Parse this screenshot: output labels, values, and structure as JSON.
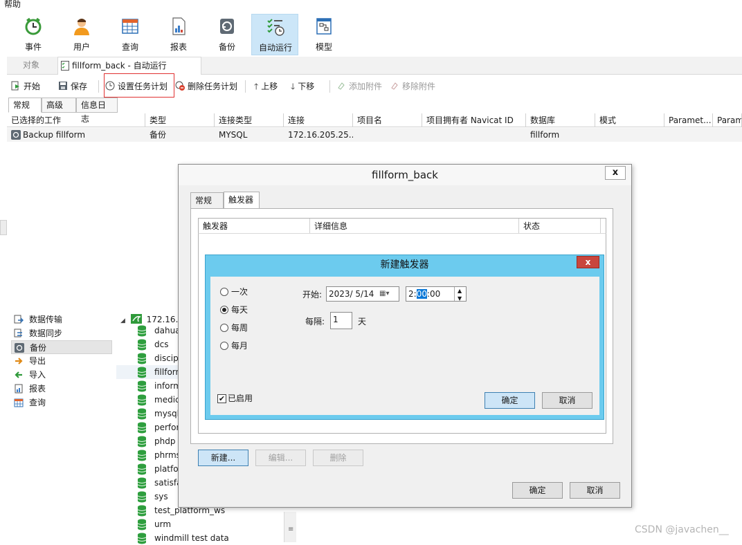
{
  "menu": {
    "help": "帮助"
  },
  "ribbon": {
    "event": "事件",
    "user": "用户",
    "query": "查询",
    "report": "报表",
    "backup": "备份",
    "automation": "自动运行",
    "model": "模型"
  },
  "tabs": {
    "objects": "对象",
    "active": "fillform_back - 自动运行"
  },
  "toolbar": {
    "start": "开始",
    "save": "保存",
    "set_schedule": "设置任务计划",
    "delete_schedule": "删除任务计划",
    "move_up": "上移",
    "move_down": "下移",
    "add_attachment": "添加附件",
    "remove_attachment": "移除附件"
  },
  "subtabs": [
    "常规",
    "高级",
    "信息日志"
  ],
  "grid": {
    "headers": [
      "已选择的工作",
      "类型",
      "连接类型",
      "连接",
      "项目名",
      "项目拥有者 Navicat ID",
      "数据库",
      "模式",
      "Paramet...",
      "Param"
    ],
    "row": [
      "Backup fillform",
      "备份",
      "MYSQL",
      "172.16.205.25...",
      "",
      "",
      "fillform",
      "",
      "",
      ""
    ]
  },
  "nav": {
    "items": [
      "数据传输",
      "数据同步",
      "备份",
      "导出",
      "导入",
      "报表",
      "查询"
    ],
    "selected": "备份"
  },
  "tree": {
    "server": "172.16.2",
    "databases": [
      "dahua",
      "dcs",
      "discip",
      "fillforn",
      "inform",
      "medic",
      "mysql",
      "perfor",
      "phdp",
      "phrms",
      "platfo",
      "satisfa",
      "sys",
      "test_platform_ws",
      "urm",
      "windmill test data"
    ]
  },
  "dialog": {
    "title": "fillform_back",
    "close": "x",
    "tabs": [
      "常规",
      "触发器"
    ],
    "columns": [
      "触发器",
      "详细信息",
      "状态"
    ],
    "new_button": "新建...",
    "edit_button": "编辑...",
    "delete_button": "删除",
    "ok": "确定",
    "cancel": "取消"
  },
  "trigger_dialog": {
    "title": "新建触发器",
    "close": "x",
    "options": [
      "一次",
      "每天",
      "每周",
      "每月"
    ],
    "selected_option": "每天",
    "start_label": "开始:",
    "start_date": "2023/ 5/14",
    "start_time_h": "2:",
    "start_time_m": "00",
    "start_time_s": ":00",
    "interval_label": "每隔:",
    "interval_value": "1",
    "interval_unit": "天",
    "enabled_label": "已启用",
    "enabled": true,
    "ok": "确定",
    "cancel": "取消"
  },
  "watermark": "CSDN @javachen__",
  "colors": {
    "trigger_title_bar": "#6ccbee",
    "close_red": "#c9463d",
    "highlight_box": "#e03030",
    "ribbon_active": "#cce6f8"
  }
}
